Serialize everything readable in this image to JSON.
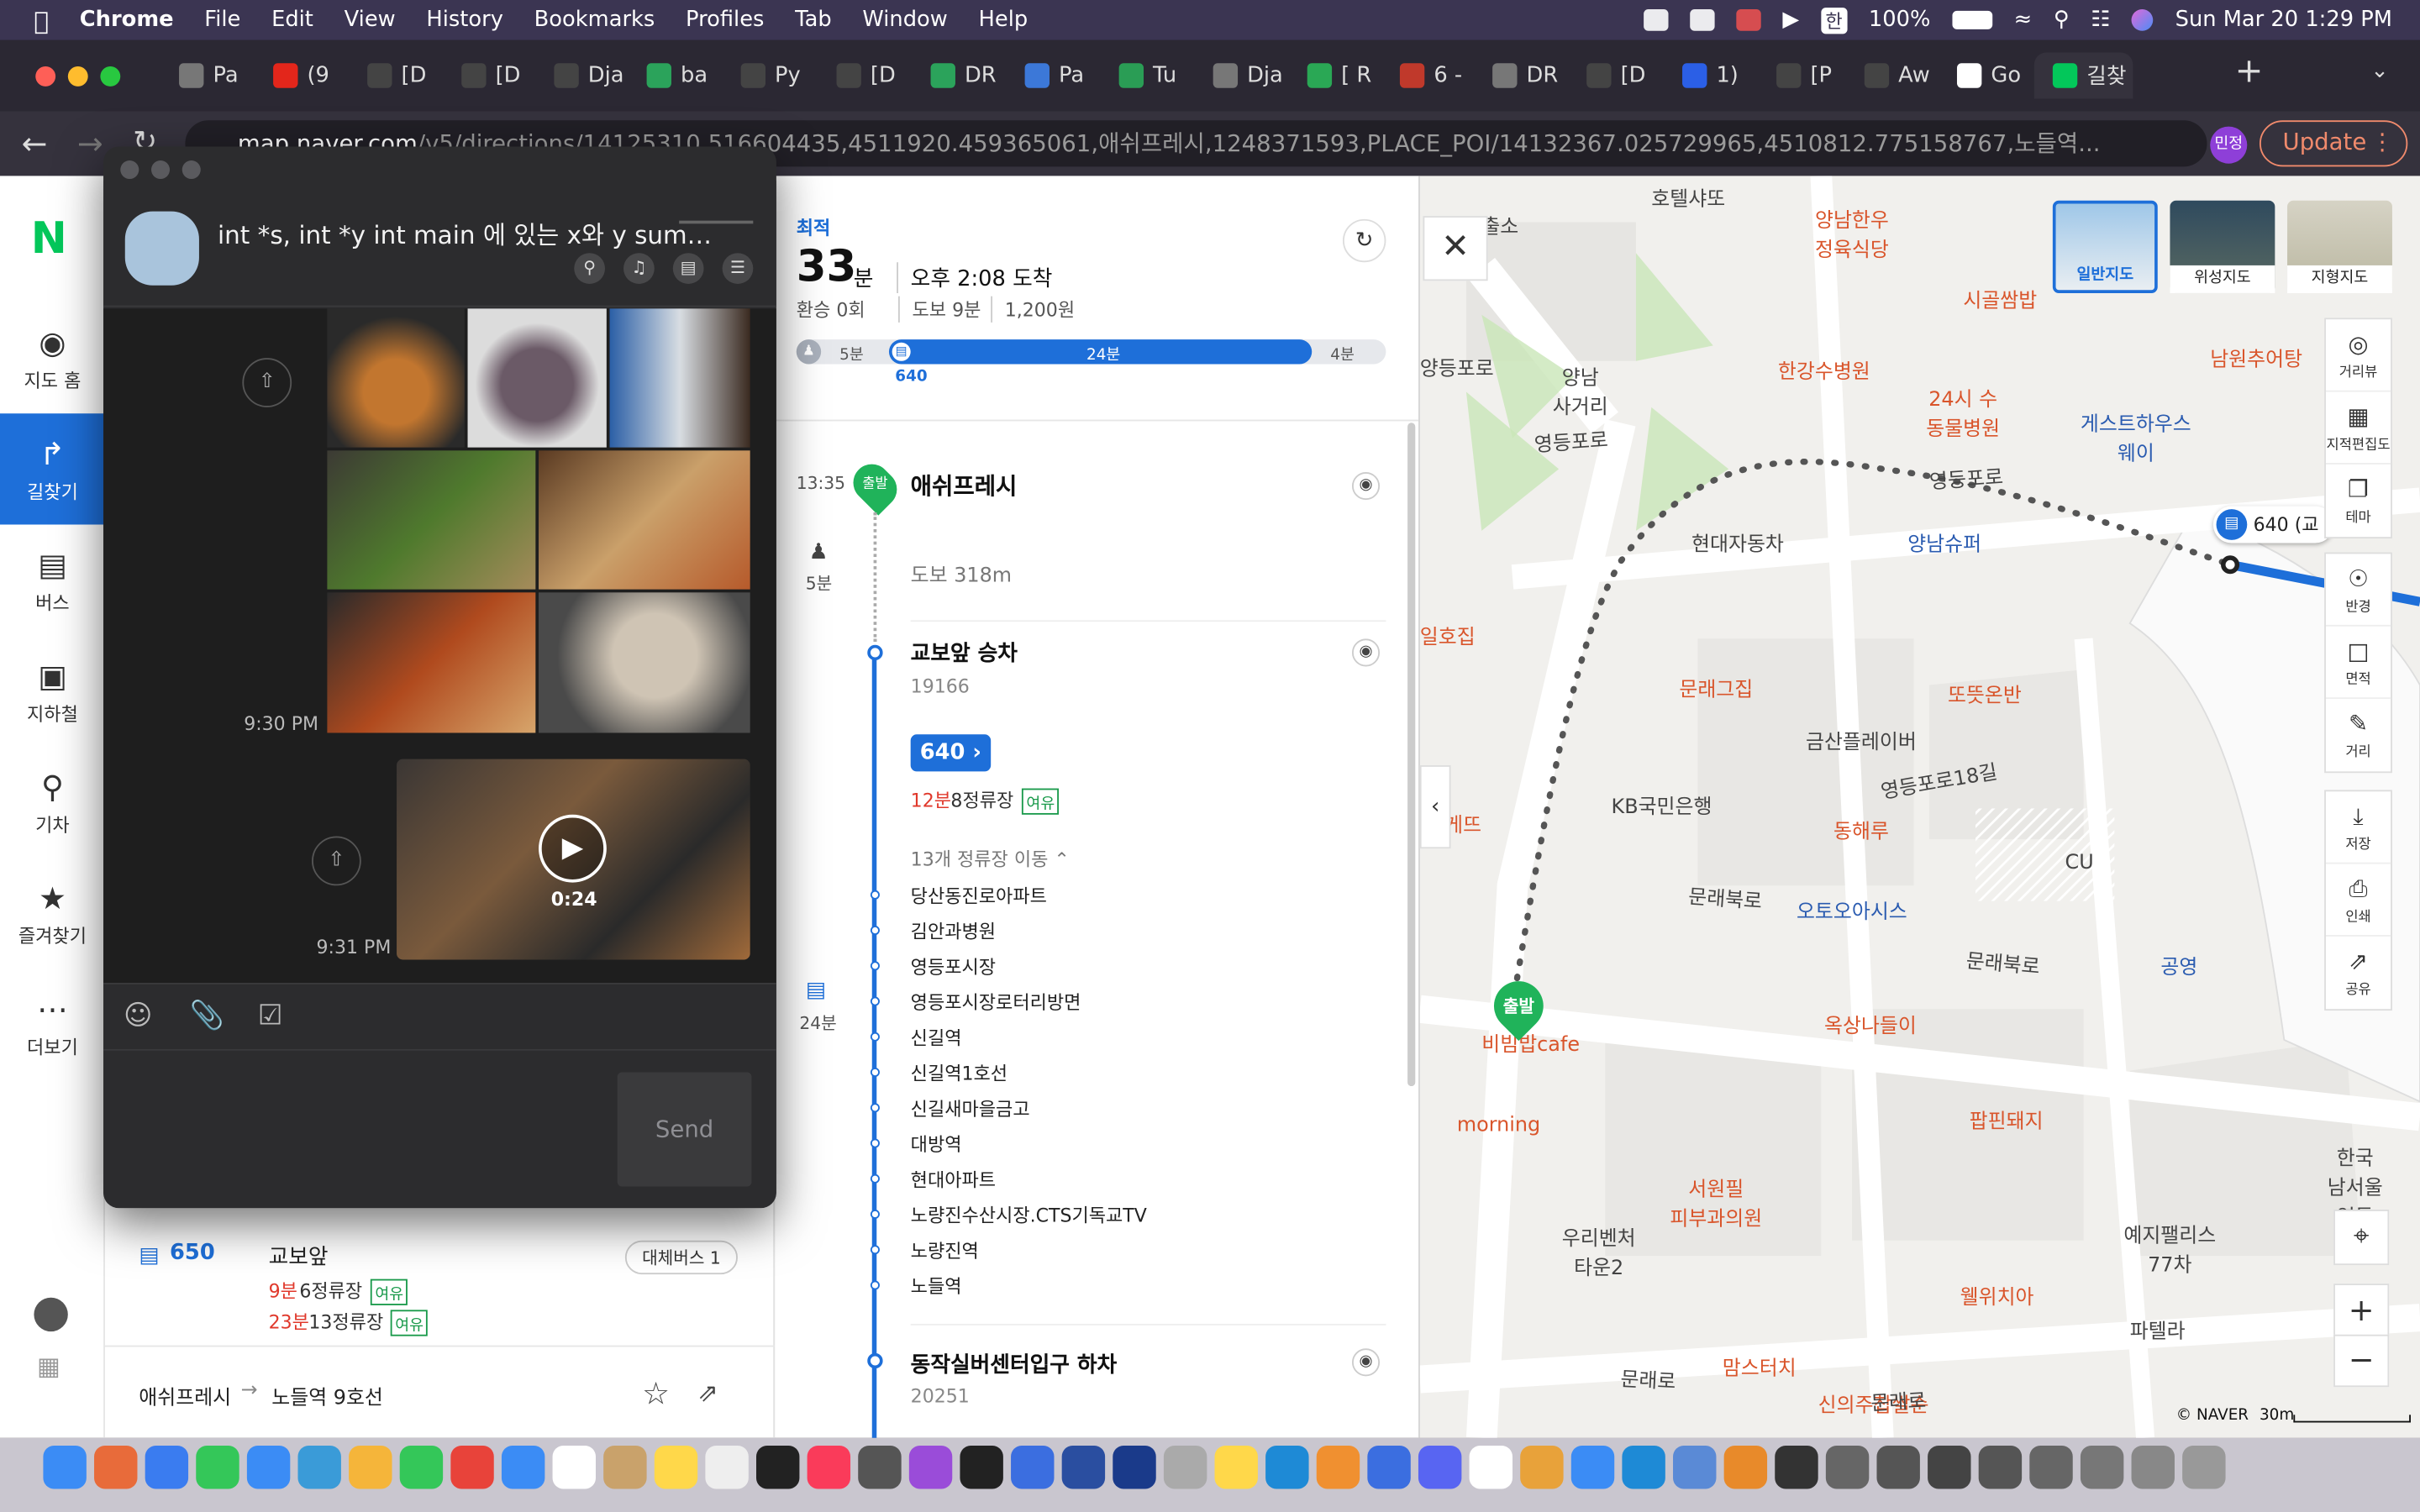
{
  "menubar": {
    "app": "Chrome",
    "menus": [
      "File",
      "Edit",
      "View",
      "History",
      "Bookmarks",
      "Profiles",
      "Tab",
      "Window",
      "Help"
    ],
    "battery": "100%",
    "datetime": "Sun Mar 20  1:29 PM",
    "ime": "한"
  },
  "tabs": [
    {
      "label": "Pa",
      "icon": "globe-icon"
    },
    {
      "label": "(9",
      "icon": "youtube-icon"
    },
    {
      "label": "[D",
      "icon": "tab-icon"
    },
    {
      "label": "[D",
      "icon": "tab-icon"
    },
    {
      "label": "Dja",
      "icon": "tab-icon"
    },
    {
      "label": "ba",
      "icon": "tab-icon"
    },
    {
      "label": "Py",
      "icon": "tab-icon"
    },
    {
      "label": "[D",
      "icon": "tab-icon"
    },
    {
      "label": "DR",
      "icon": "tab-icon"
    },
    {
      "label": "Pa",
      "icon": "tab-icon"
    },
    {
      "label": "Tu",
      "icon": "tab-icon"
    },
    {
      "label": "Dja",
      "icon": "globe-icon"
    },
    {
      "label": "[ R",
      "icon": "tab-icon"
    },
    {
      "label": "6 -",
      "icon": "tab-icon"
    },
    {
      "label": "DR",
      "icon": "tab-icon"
    },
    {
      "label": "[D",
      "icon": "tab-icon"
    },
    {
      "label": "1) ",
      "icon": "tab-icon"
    },
    {
      "label": "[P",
      "icon": "tab-icon"
    },
    {
      "label": "Aw",
      "icon": "tab-icon"
    },
    {
      "label": "Go",
      "icon": "google-icon"
    },
    {
      "label": "길찾",
      "icon": "naver-icon"
    }
  ],
  "toolbar": {
    "url_domain": "map.naver.com",
    "url_path": "/v5/directions/14125310.516604435,4511920.459365061,애쉬프레시,1248371593,PLACE_POI/14132367.025729965,4510812.775158767,노들역...",
    "profile": "민정",
    "update_label": "Update"
  },
  "leftnav": [
    {
      "label": "지도 홈",
      "icon": "map-pin-icon"
    },
    {
      "label": "길찾기",
      "icon": "directions-icon"
    },
    {
      "label": "버스",
      "icon": "bus-icon"
    },
    {
      "label": "지하철",
      "icon": "subway-icon"
    },
    {
      "label": "기차",
      "icon": "train-icon"
    },
    {
      "label": "즐겨찾기",
      "icon": "star-icon"
    },
    {
      "label": "더보기",
      "icon": "more-icon"
    }
  ],
  "route_list": {
    "alt_route": {
      "bus": "650",
      "stop": "교보앞",
      "alt_label": "대체버스 1",
      "line1_time": "9분",
      "line1_rest": "6정류장",
      "line2_time": "23분",
      "line2_rest": "13정류장",
      "badge": "여유"
    },
    "footer": {
      "from": "애쉬프레시",
      "to": "노들역 9호선"
    }
  },
  "detail": {
    "tag": "최적",
    "minutes": "33",
    "min_unit": "분",
    "arrival": "오후 2:08 도착",
    "transfer": "환승 0회",
    "walk": "도보 9분",
    "fare": "1,200원",
    "bar": {
      "walk1": "5분",
      "ride": "24분",
      "walk2": "4분",
      "bus": "640"
    },
    "start_time": "13:35",
    "start_badge": "출발",
    "start_place": "애쉬프레시",
    "walk_min": "5분",
    "walk_dist": "도보 318m",
    "board_stop": "교보앞 승차",
    "board_stop_id": "19166",
    "bus_no": "640",
    "bus_eta": "12분",
    "bus_eta_rest": "8정류장",
    "bus_badge": "여유",
    "ride_min": "24분",
    "stops_label": "13개 정류장 이동",
    "stops": [
      "당산동진로아파트",
      "김안과병원",
      "영등포시장",
      "영등포시장로터리방면",
      "신길역",
      "신길역1호선",
      "신길새마을금고",
      "대방역",
      "현대아파트",
      "노량진수산시장.CTS기독교TV",
      "노량진역",
      "노들역"
    ],
    "alight_stop": "동작실버센터입구 하차",
    "alight_id": "20251"
  },
  "chat": {
    "title": "int *s, int *y int main 에 있는 x와 y sum…",
    "time1": "9:30 PM",
    "time2": "9:31 PM",
    "video_len": "0:24",
    "send": "Send"
  },
  "map": {
    "layers": [
      "일반지도",
      "위성지도",
      "지형지도"
    ],
    "tools": [
      "거리뷰",
      "지적편집도",
      "테마",
      "반경",
      "면적",
      "거리",
      "저장",
      "인쇄",
      "공유"
    ],
    "bus_marker": "640 (교",
    "start_marker": "출발",
    "scale": "30m",
    "copyright": "© NAVER",
    "labels": [
      {
        "t": "호텔샤또",
        "c": ""
      },
      {
        "t": "출소",
        "c": ""
      },
      {
        "t": "양남한우\n정육식당",
        "c": "red"
      },
      {
        "t": "시골쌈밥",
        "c": "red"
      },
      {
        "t": "남원추어탕",
        "c": "red"
      },
      {
        "t": "한강수병원",
        "c": "red"
      },
      {
        "t": "24시 수\n동물병원",
        "c": "red"
      },
      {
        "t": "양남\n사거리",
        "c": ""
      },
      {
        "t": "게스트하우스\n웨이",
        "c": "blue"
      },
      {
        "t": "현대자동차",
        "c": ""
      },
      {
        "t": "양남슈퍼",
        "c": "blue"
      },
      {
        "t": "일호집",
        "c": "red"
      },
      {
        "t": "문래그집",
        "c": "red"
      },
      {
        "t": "또뜻온반",
        "c": "red"
      },
      {
        "t": "금산플레이버",
        "c": ""
      },
      {
        "t": "KB국민은행",
        "c": ""
      },
      {
        "t": "동해루",
        "c": "red"
      },
      {
        "t": "CU",
        "c": ""
      },
      {
        "t": "오토오아시스",
        "c": "blue"
      },
      {
        "t": "공영",
        "c": "blue"
      },
      {
        "t": "옥상나들이",
        "c": "red"
      },
      {
        "t": "비빔밥cafe",
        "c": "red"
      },
      {
        "t": "morning",
        "c": "red"
      },
      {
        "t": "팝핀돼지",
        "c": "red"
      },
      {
        "t": "서원필\n피부과의원",
        "c": "red"
      },
      {
        "t": "우리벤처\n타운2",
        "c": ""
      },
      {
        "t": "예지팰리스\n77차",
        "c": ""
      },
      {
        "t": "파텔라",
        "c": ""
      },
      {
        "t": "웰위치아",
        "c": "red"
      },
      {
        "t": "맘스터치",
        "c": "red"
      },
      {
        "t": "신의주찹쌀순",
        "c": "red"
      },
      {
        "t": "한국\n남서울\n영등",
        "c": ""
      },
      {
        "t": "영등포로",
        "c": ""
      },
      {
        "t": "영등포로",
        "c": ""
      },
      {
        "t": "영등포로18길",
        "c": ""
      },
      {
        "t": "문래북로",
        "c": ""
      },
      {
        "t": "문래북로",
        "c": ""
      },
      {
        "t": "문래로",
        "c": ""
      },
      {
        "t": "문래로",
        "c": ""
      },
      {
        "t": "양등포로",
        "c": ""
      },
      {
        "t": "게뜨",
        "c": "red"
      }
    ]
  }
}
